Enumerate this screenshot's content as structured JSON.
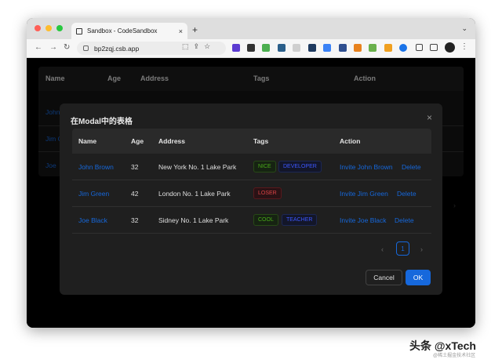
{
  "browser": {
    "tab_title": "Sandbox - CodeSandbox",
    "url": "bp2zqj.csb.app",
    "close_tab": "×",
    "new_tab": "+",
    "tab_menu": "⌄",
    "back": "←",
    "forward": "→",
    "reload": "↻",
    "star": "☆",
    "extensions": "⧉",
    "more": "⋮"
  },
  "background_table": {
    "headers": {
      "name": "Name",
      "age": "Age",
      "address": "Address",
      "tags": "Tags",
      "action": "Action"
    },
    "names": [
      "John",
      "Jim G",
      "Joe"
    ]
  },
  "modal": {
    "title": "在Modal中的表格",
    "close": "×",
    "columns": {
      "name": "Name",
      "age": "Age",
      "address": "Address",
      "tags": "Tags",
      "action": "Action"
    },
    "rows": [
      {
        "name": "John Brown",
        "age": "32",
        "address": "New York No. 1 Lake Park",
        "tags": [
          "NICE",
          "DEVELOPER"
        ],
        "invite": "Invite John Brown",
        "delete": "Delete"
      },
      {
        "name": "Jim Green",
        "age": "42",
        "address": "London No. 1 Lake Park",
        "tags": [
          "LOSER"
        ],
        "invite": "Invite Jim Green",
        "delete": "Delete"
      },
      {
        "name": "Joe Black",
        "age": "32",
        "address": "Sidney No. 1 Lake Park",
        "tags": [
          "COOL",
          "TEACHER"
        ],
        "invite": "Invite Joe Black",
        "delete": "Delete"
      }
    ],
    "pagination": {
      "prev": "‹",
      "current": "1",
      "next": "›"
    },
    "cancel_label": "Cancel",
    "ok_label": "OK"
  },
  "watermark": {
    "text": "头条 @xTech",
    "sub": "@稀土掘金技术社区"
  },
  "colors": {
    "primary": "#1668dc",
    "modal_bg": "#1f1f1f",
    "header_bg": "#2a2a2a"
  }
}
